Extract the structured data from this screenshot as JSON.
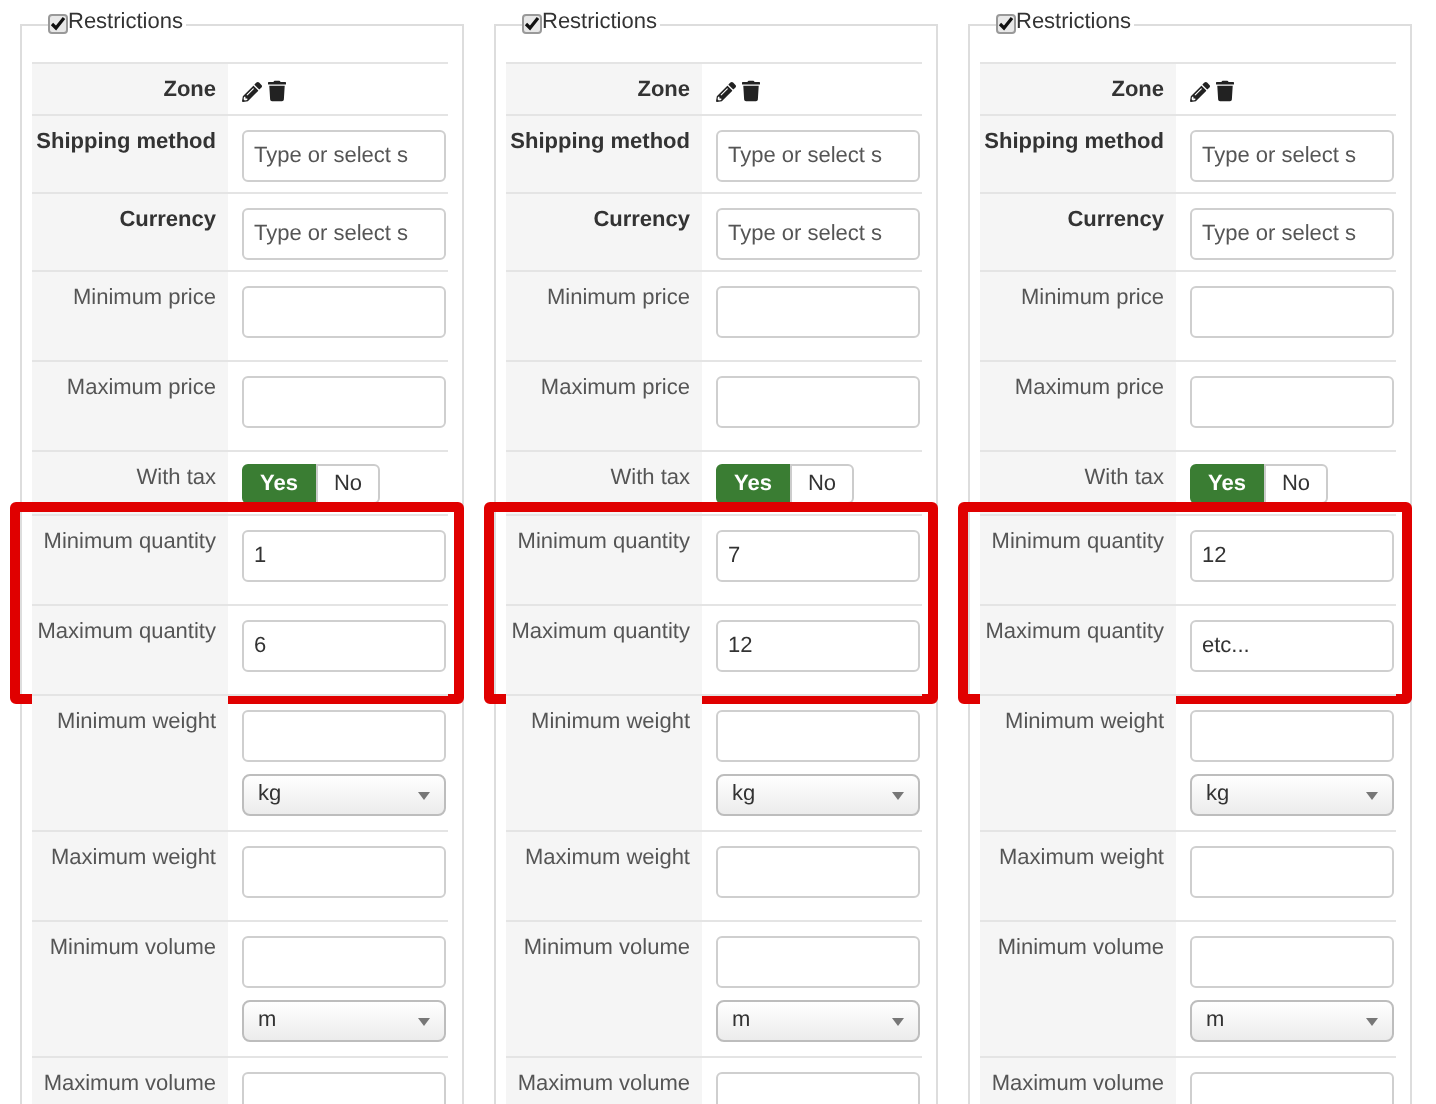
{
  "panels": [
    {
      "legend": "Restrictions",
      "checked": true,
      "groups": [
        {
          "highlighted": false,
          "rows": [
            {
              "kind": "icons",
              "label": "Zone",
              "bold": true
            },
            {
              "kind": "text",
              "label": "Shipping method",
              "bold": true,
              "placeholder": "Type or select s"
            },
            {
              "kind": "text",
              "label": "Currency",
              "bold": true,
              "placeholder": "Type or select s"
            },
            {
              "kind": "text",
              "label": "Minimum price",
              "bold": false
            },
            {
              "kind": "text",
              "label": "Maximum price",
              "bold": false
            },
            {
              "kind": "toggle",
              "label": "With tax",
              "bold": false,
              "options": [
                {
                  "label": "Yes",
                  "selected": true
                },
                {
                  "label": "No",
                  "selected": false
                }
              ]
            }
          ]
        },
        {
          "highlighted": true,
          "rows": [
            {
              "kind": "text",
              "label": "Minimum quantity",
              "bold": false,
              "value": "1"
            },
            {
              "kind": "text",
              "label": "Maximum quantity",
              "bold": false,
              "value": "6"
            }
          ]
        },
        {
          "highlighted": false,
          "rows": [
            {
              "kind": "unit",
              "label": "Minimum weight",
              "bold": false,
              "unit": "kg"
            },
            {
              "kind": "text",
              "label": "Maximum weight",
              "bold": false
            },
            {
              "kind": "unit",
              "label": "Minimum volume",
              "bold": false,
              "unit": "m"
            },
            {
              "kind": "text",
              "label": "Maximum volume",
              "bold": false
            }
          ]
        }
      ]
    },
    {
      "legend": "Restrictions",
      "checked": true,
      "groups": [
        {
          "highlighted": false,
          "rows": [
            {
              "kind": "icons",
              "label": "Zone",
              "bold": true
            },
            {
              "kind": "text",
              "label": "Shipping method",
              "bold": true,
              "placeholder": "Type or select s"
            },
            {
              "kind": "text",
              "label": "Currency",
              "bold": true,
              "placeholder": "Type or select s"
            },
            {
              "kind": "text",
              "label": "Minimum price",
              "bold": false
            },
            {
              "kind": "text",
              "label": "Maximum price",
              "bold": false
            },
            {
              "kind": "toggle",
              "label": "With tax",
              "bold": false,
              "options": [
                {
                  "label": "Yes",
                  "selected": true
                },
                {
                  "label": "No",
                  "selected": false
                }
              ]
            }
          ]
        },
        {
          "highlighted": true,
          "rows": [
            {
              "kind": "text",
              "label": "Minimum quantity",
              "bold": false,
              "value": "7"
            },
            {
              "kind": "text",
              "label": "Maximum quantity",
              "bold": false,
              "value": "12"
            }
          ]
        },
        {
          "highlighted": false,
          "rows": [
            {
              "kind": "unit",
              "label": "Minimum weight",
              "bold": false,
              "unit": "kg"
            },
            {
              "kind": "text",
              "label": "Maximum weight",
              "bold": false
            },
            {
              "kind": "unit",
              "label": "Minimum volume",
              "bold": false,
              "unit": "m"
            },
            {
              "kind": "text",
              "label": "Maximum volume",
              "bold": false
            }
          ]
        }
      ]
    },
    {
      "legend": "Restrictions",
      "checked": true,
      "groups": [
        {
          "highlighted": false,
          "rows": [
            {
              "kind": "icons",
              "label": "Zone",
              "bold": true
            },
            {
              "kind": "text",
              "label": "Shipping method",
              "bold": true,
              "placeholder": "Type or select s"
            },
            {
              "kind": "text",
              "label": "Currency",
              "bold": true,
              "placeholder": "Type or select s"
            },
            {
              "kind": "text",
              "label": "Minimum price",
              "bold": false
            },
            {
              "kind": "text",
              "label": "Maximum price",
              "bold": false
            },
            {
              "kind": "toggle",
              "label": "With tax",
              "bold": false,
              "options": [
                {
                  "label": "Yes",
                  "selected": true
                },
                {
                  "label": "No",
                  "selected": false
                }
              ]
            }
          ]
        },
        {
          "highlighted": true,
          "rows": [
            {
              "kind": "text",
              "label": "Minimum quantity",
              "bold": false,
              "value": "12"
            },
            {
              "kind": "text",
              "label": "Maximum quantity",
              "bold": false,
              "value": "etc..."
            }
          ]
        },
        {
          "highlighted": false,
          "rows": [
            {
              "kind": "unit",
              "label": "Minimum weight",
              "bold": false,
              "unit": "kg"
            },
            {
              "kind": "text",
              "label": "Maximum weight",
              "bold": false
            },
            {
              "kind": "unit",
              "label": "Minimum volume",
              "bold": false,
              "unit": "m"
            },
            {
              "kind": "text",
              "label": "Maximum volume",
              "bold": false
            }
          ]
        }
      ]
    }
  ]
}
